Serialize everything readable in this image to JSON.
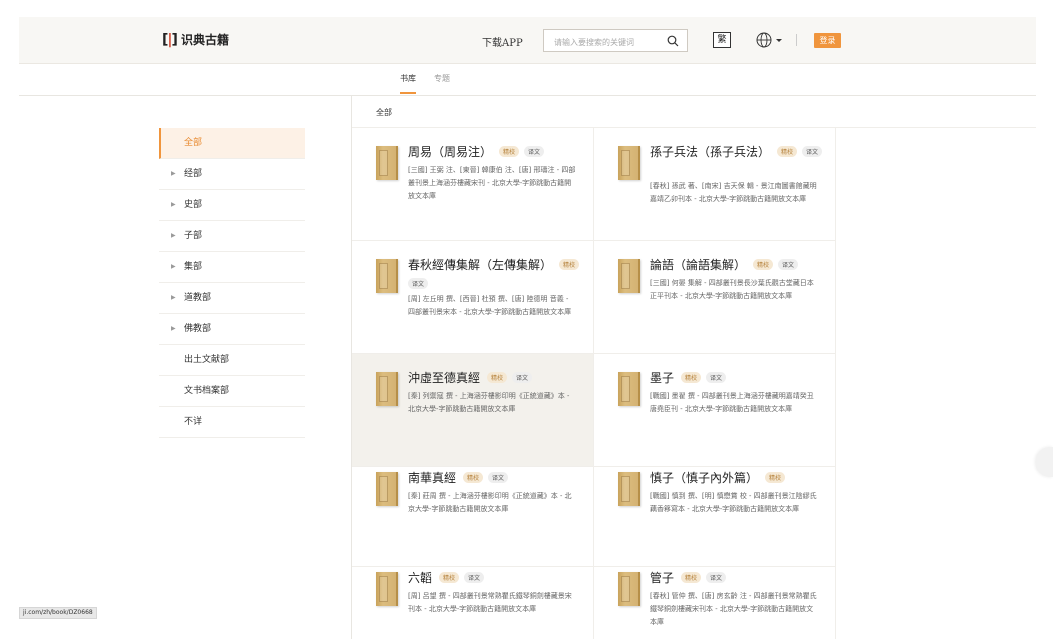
{
  "header": {
    "logo_mark": "[ ]",
    "logo_text": "识典古籍",
    "download_label": "下载APP",
    "search_placeholder": "请输入要搜索的关键词",
    "fan_label": "繁",
    "login_label": "登录",
    "accent_color": "#f0953d"
  },
  "tabs": [
    {
      "label": "书库",
      "active": true
    },
    {
      "label": "专题",
      "active": false
    }
  ],
  "breadcrumb": "全部",
  "nav": [
    {
      "label": "全部",
      "active": true,
      "expandable": false
    },
    {
      "label": "经部",
      "expandable": true
    },
    {
      "label": "史部",
      "expandable": true
    },
    {
      "label": "子部",
      "expandable": true
    },
    {
      "label": "集部",
      "expandable": true
    },
    {
      "label": "道教部",
      "expandable": true
    },
    {
      "label": "佛教部",
      "expandable": true
    },
    {
      "label": "出土文献部",
      "expandable": false
    },
    {
      "label": "文书档案部",
      "expandable": false
    },
    {
      "label": "不详",
      "expandable": false
    }
  ],
  "books": [
    {
      "title": "周易（周易注）",
      "tags": [
        "精校",
        "译文"
      ],
      "desc": "[三國] 王弼 注、[東晉] 韓康伯 注、[唐] 邢璹注 - 四部叢刊景上海涵芬樓藏宋刊 - 北京大學-字節跳動古籍開放文本庫"
    },
    {
      "title": "孫子兵法（孫子兵法）",
      "tags": [
        "精校",
        "译文"
      ],
      "desc": "[春秋] 孫武 著、[南宋] 吉天保 輯 - 景江南圖書館藏明嘉靖乙卯刊本 - 北京大學-字節跳動古籍開放文本庫"
    },
    {
      "title": "春秋經傳集解（左傳集解）",
      "tags": [
        "精校",
        "译文"
      ],
      "desc": "[周] 左丘明 撰、[西晉] 杜預 撰、[唐] 陸德明 音義 - 四部叢刊景宋本 - 北京大學-字節跳動古籍開放文本庫"
    },
    {
      "title": "論語（論語集解）",
      "tags": [
        "精校",
        "译文"
      ],
      "desc": "[三國] 何晏 集解 - 四部叢刊景長沙葉氏觀古堂藏日本正平刊本 - 北京大學-字節跳動古籍開放文本庫"
    },
    {
      "title": "沖虛至德真經",
      "tags": [
        "精校",
        "译文"
      ],
      "desc": "[秦] 列禦寇 撰 - 上海涵芬樓影印明《正統道藏》本 - 北京大學-字節跳動古籍開放文本庫"
    },
    {
      "title": "墨子",
      "tags": [
        "精校",
        "译文"
      ],
      "desc": "[戰國] 墨翟 撰 - 四部叢刊景上海涵芬樓藏明嘉靖癸丑唐堯臣刊 - 北京大學-字節跳動古籍開放文本庫"
    },
    {
      "title": "南華真經",
      "tags": [
        "精校",
        "译文"
      ],
      "desc": "[秦] 莊周 撰 - 上海涵芬樓影印明《正統道藏》本 - 北京大學-字節跳動古籍開放文本庫"
    },
    {
      "title": "慎子（慎子內外篇）",
      "tags": [
        "精校"
      ],
      "desc": "[戰國] 慎到 撰、[明] 慎懋賞 校 - 四部叢刊景江陰繆氏藕香簃寫本 - 北京大學-字節跳動古籍開放文本庫"
    },
    {
      "title": "六韜",
      "tags": [
        "精校",
        "译文"
      ],
      "desc": "[周] 呂望 撰 - 四部叢刊景常熟瞿氏鐵琴銅劍樓藏景宋刊本 - 北京大學-字節跳動古籍開放文本庫"
    },
    {
      "title": "管子",
      "tags": [
        "精校",
        "译文"
      ],
      "desc": "[春秋] 管仲 撰、[唐] 房玄齡 注 - 四部叢刊景常熟瞿氏鐵琴銅劍樓藏宋刊本 - 北京大學-字節跳動古籍開放文本庫"
    }
  ],
  "status_url": "ji.com/zh/book/DZ0668"
}
